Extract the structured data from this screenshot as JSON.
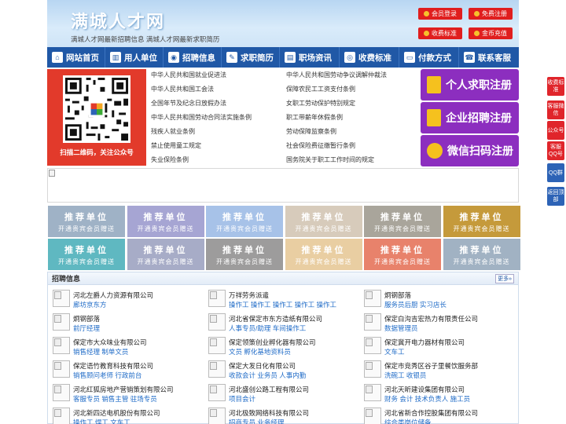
{
  "header": {
    "title": "满城人才网",
    "subtitle": "满城人才网最新招聘信息   满城人才网最新求职简历",
    "buttons": [
      {
        "label": "会员登录",
        "icon": "coin-icon"
      },
      {
        "label": "免费注册",
        "icon": "coin-icon"
      },
      {
        "label": "收费标准",
        "icon": "coin-icon"
      },
      {
        "label": "金币充值",
        "icon": "coin-icon"
      }
    ]
  },
  "nav": [
    {
      "label": "网站首页",
      "icon": "home-icon",
      "glyph": "⌂"
    },
    {
      "label": "用人单位",
      "icon": "building-icon",
      "glyph": "▥"
    },
    {
      "label": "招聘信息",
      "icon": "megaphone-icon",
      "glyph": "◉"
    },
    {
      "label": "求职简历",
      "icon": "resume-icon",
      "glyph": "✎"
    },
    {
      "label": "职场资讯",
      "icon": "news-icon",
      "glyph": "▤"
    },
    {
      "label": "收费标准",
      "icon": "stamp-icon",
      "glyph": "◎"
    },
    {
      "label": "付款方式",
      "icon": "card-icon",
      "glyph": "▭"
    },
    {
      "label": "联系客服",
      "icon": "phone-icon",
      "glyph": "☎"
    }
  ],
  "qr": {
    "caption": "扫描二维码，关注公众号"
  },
  "laws": {
    "left": [
      "中华人民共和国就业促进法",
      "中华人民共和国工会法",
      "全国年节及纪念日放假办法",
      "中华人民共和国劳动合同法实施条例",
      "残疾人就业条例",
      "禁止使用童工规定",
      "失业保险条例"
    ],
    "right": [
      "中华人民共和国劳动争议调解仲裁法",
      "保障农民工工资支付条例",
      "女职工劳动保护特别规定",
      "职工带薪年休假条例",
      "劳动保障监察条例",
      "社会保险费征缴暂行条例",
      "国务院关于职工工作时间的规定"
    ]
  },
  "cards": [
    {
      "label": "个人求职注册",
      "icon": "person-icon"
    },
    {
      "label": "企业招聘注册",
      "icon": "company-icon"
    },
    {
      "label": "微信扫码注册",
      "icon": "wechat-icon"
    }
  ],
  "recommend": {
    "title": "推荐单位",
    "subtitle": "开通贵宾会员赠送",
    "colors": [
      "#9fb2c6",
      "#a6a5d3",
      "#a7c2e8",
      "#d7cbbb",
      "#a9a59b",
      "#c59a3b",
      "#5fb8c1",
      "#a7acc7",
      "#9d9c9c",
      "#e9cea2",
      "#e8826b",
      "#a1b2c3"
    ]
  },
  "jobs": {
    "title": "招聘信息",
    "more": "更多»",
    "items": [
      {
        "company": "河北左爵人力资源有限公司",
        "positions": "廊坊京东方"
      },
      {
        "company": "万祥劳务派遣",
        "positions": "操作工 操作工 操作工 操作工 操作工"
      },
      {
        "company": "炯钢部落",
        "positions": "服务员后厨 实习店长"
      },
      {
        "company": "炯钢部落",
        "positions": "前厅经理"
      },
      {
        "company": "河北省保定市东方造纸有限公司",
        "positions": "人事专员/助理 车间操作工"
      },
      {
        "company": "保定白沟吉宏热力有限责任公司",
        "positions": "数据管理员"
      },
      {
        "company": "保定市大众味业有限公司",
        "positions": "销售经理 制单文员"
      },
      {
        "company": "保定领策创业孵化器有限公司",
        "positions": "文员 孵化基地资料员"
      },
      {
        "company": "保定冀开电力器材有限公司",
        "positions": "文车工"
      },
      {
        "company": "保定语竹教育科技有限公司",
        "positions": "销售顾问老师 行政前台"
      },
      {
        "company": "保定大发日化有限公司",
        "positions": "收款会计 业务员 人事内勤"
      },
      {
        "company": "保定市竞秀区谷子里餐饮服务部",
        "positions": "洗碗工 收银员"
      },
      {
        "company": "河北红狐房地产营销策划有限公司",
        "positions": "客服专员 销售主管 驻场专员"
      },
      {
        "company": "河北盛创公路工程有限公司",
        "positions": "项目会计"
      },
      {
        "company": "河北天昕建设集团有限公司",
        "positions": "财务 会计 技术负责人 施工员"
      },
      {
        "company": "河北新四达电机股份有限公司",
        "positions": "操作工 焊工 文车工"
      },
      {
        "company": "河北极致网络科技有限公司",
        "positions": "招商专员 业务经理"
      },
      {
        "company": "河北省新合作控股集团有限公司",
        "positions": "综合类岗位储备"
      }
    ]
  },
  "sidefloat": [
    "收费标准",
    "客服微信",
    "公众号",
    "客服QQ号",
    "QQ群",
    "返回顶部"
  ]
}
